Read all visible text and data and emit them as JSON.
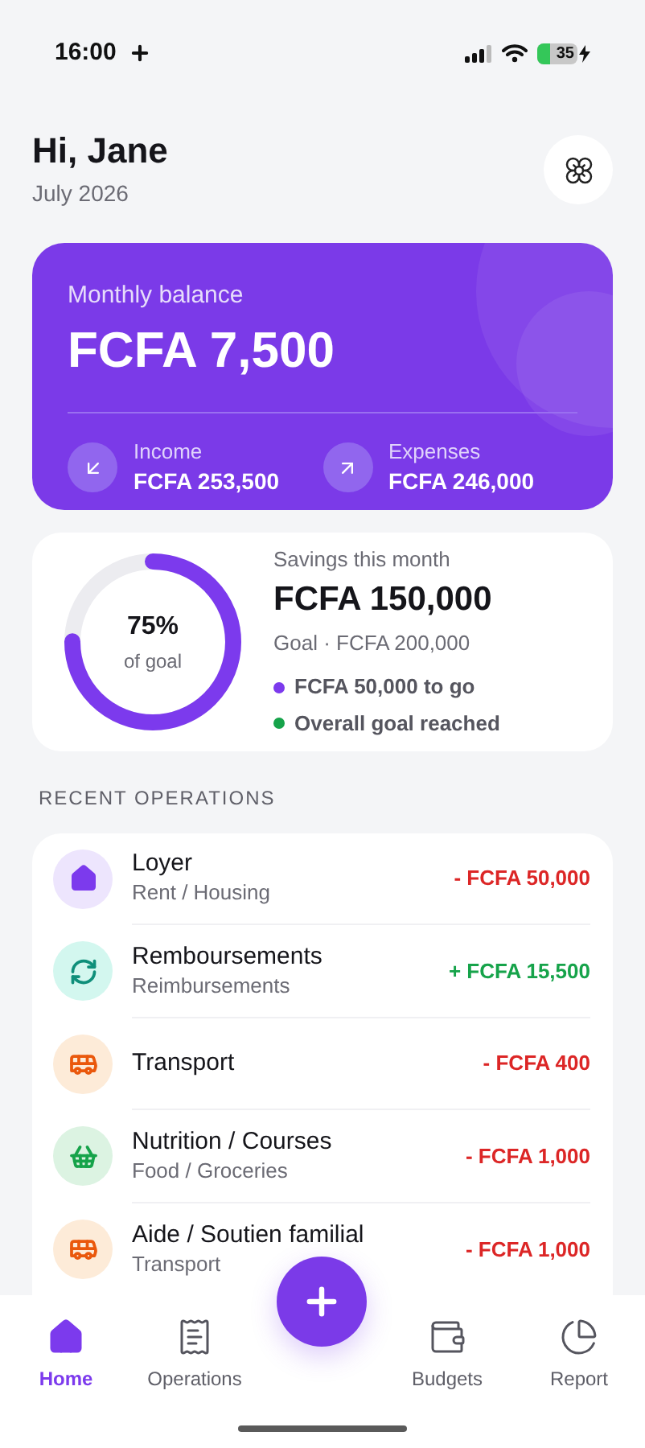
{
  "status_bar": {
    "time": "16:00",
    "battery": "35"
  },
  "header": {
    "greeting": "Hi, Jane",
    "date": "July 2026"
  },
  "balance": {
    "label": "Monthly balance",
    "amount": "FCFA 7,500",
    "stats": [
      {
        "kind": "income",
        "label": "Income",
        "amount": "FCFA 253,500"
      },
      {
        "kind": "expense",
        "label": "Expenses",
        "amount": "FCFA 246,000"
      }
    ]
  },
  "savings": {
    "level": 0.75,
    "percent": "75%",
    "percent_caption": "of goal",
    "title": "Savings this month",
    "amount": "FCFA 150,000",
    "goal": "Goal · FCFA 200,000",
    "notes": [
      {
        "text": "FCFA 50,000 to go",
        "color": "#7c3aed"
      },
      {
        "text": "Overall goal reached",
        "color": "#16a34a"
      }
    ]
  },
  "section_title": "RECENT OPERATIONS",
  "operations": [
    {
      "kind": "housing",
      "title": "Loyer",
      "subtitle": "Rent / Housing",
      "amount": "- FCFA 50,000",
      "credit": false
    },
    {
      "kind": "refund",
      "title": "Remboursements",
      "subtitle": "Reimbursements",
      "amount": "+ FCFA 15,500",
      "credit": true
    },
    {
      "kind": "transport",
      "title": "Transport",
      "amount": "- FCFA 400",
      "credit": false
    },
    {
      "kind": "food",
      "title": "Nutrition / Courses",
      "subtitle": "Food / Groceries",
      "amount": "- FCFA 1,000",
      "credit": false
    },
    {
      "kind": "transport",
      "title": "Aide / Soutien familial",
      "subtitle": "Transport",
      "amount": "- FCFA 1,000",
      "credit": false
    }
  ],
  "nav": [
    {
      "kind": "home",
      "label": "Home",
      "selected": true
    },
    {
      "kind": "list",
      "label": "Operations",
      "selected": false
    },
    {
      "kind": "wallet",
      "label": "Budgets",
      "selected": false
    },
    {
      "kind": "chart",
      "label": "Report",
      "selected": false
    }
  ]
}
